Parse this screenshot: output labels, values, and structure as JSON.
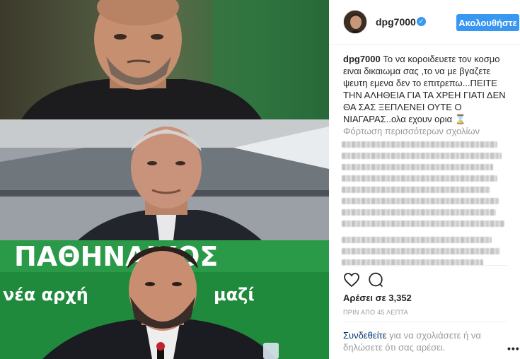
{
  "post": {
    "username": "dpg7000",
    "verified_icon": "verified-badge-icon",
    "follow_label": "Ακολουθήστε",
    "caption_text": "Το να κοροιδευετε τον κοσμο ειναι δικαιωμα σας ,το να με βγαζετε ψευτη εμενα δεν το επιτρεπω...ΠΕΙΤΕ ΤΗΝ ΑΛΗΘΕΙΑ ΓΙΑ ΤΑ ΧΡΕΗ ΓΙΑΤΙ ΔΕΝ ΘΑ ΣΑΣ ΞΕΠΛΕΝΕΙ ΟΥΤΕ Ο ΝΙΑΓΑΡΑΣ..ολα εχουν ορια ⌛",
    "load_more_label": "Φόρτωση περισσότερων σχολίων",
    "likes_text": "Αρέσει σε 3,352",
    "time_text": "ΠΡΙΝ ΑΠΟ 45 ΛΕΠΤΑ",
    "login_link": "Συνδεθείτε",
    "login_rest": " για να σχολιάσετε ή να δηλώσετε ότι σας αρέσει.",
    "more_label": "•••"
  },
  "image": {
    "banner_text": "ΠΑΘΗΝΑΙΚΟΣ",
    "slogan_left": "νέα αρχή",
    "slogan_right": "μαζί"
  },
  "colors": {
    "accent": "#3897f0",
    "link": "#003569",
    "muted": "#999999",
    "green": "#1f8a3c"
  }
}
